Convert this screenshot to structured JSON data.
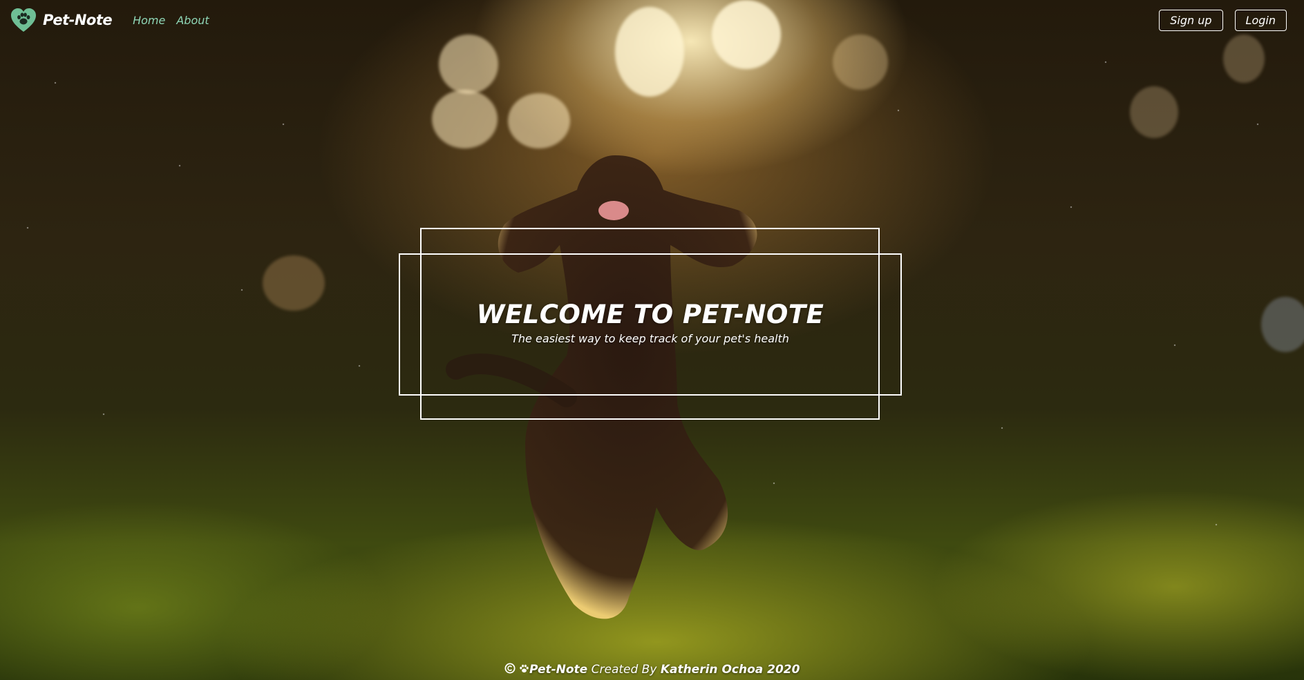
{
  "navbar": {
    "brand_name": "Pet-Note",
    "links": [
      {
        "label": "Home"
      },
      {
        "label": "About"
      }
    ],
    "signup_label": "Sign up",
    "login_label": "Login",
    "brand_icon": "heart-paw-icon",
    "brand_color": "#6fbf95"
  },
  "hero": {
    "title": "WELCOME TO PET-NOTE",
    "subtitle": "The easiest way to keep track of your pet's health"
  },
  "footer": {
    "copyright_symbol": "©",
    "brand": "Pet-Note",
    "created_by": "Created By",
    "author": "Katherin Ochoa 2020",
    "icons": [
      "copyright-icon",
      "paw-icon"
    ]
  },
  "colors": {
    "nav_link": "#8fd6b6",
    "text": "#ffffff"
  }
}
